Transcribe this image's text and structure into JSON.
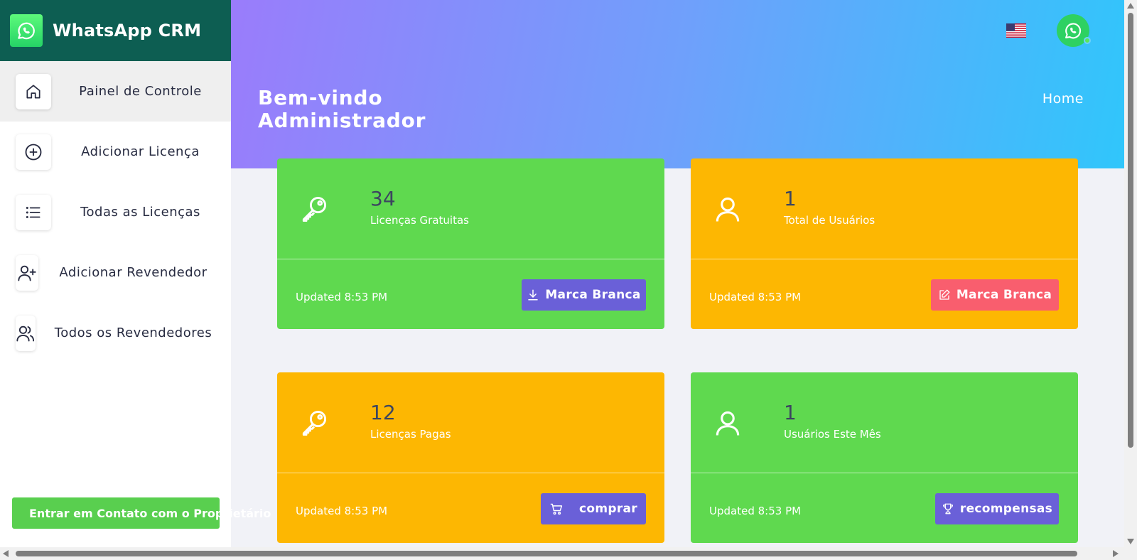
{
  "sidebar": {
    "brand_title": "WhatsApp CRM",
    "brand_icon": "whatsapp-icon",
    "items": [
      {
        "label": "Painel de Controle",
        "icon": "home-icon",
        "active": true
      },
      {
        "label": "Adicionar Licença",
        "icon": "plus-circle-icon",
        "active": false
      },
      {
        "label": "Todas as Licenças",
        "icon": "list-icon",
        "active": false
      },
      {
        "label": "Adicionar Revendedor",
        "icon": "user-plus-icon",
        "active": false
      },
      {
        "label": "Todos os Revendedores",
        "icon": "users-icon",
        "active": false
      }
    ],
    "contact_button": "Entrar em Contato com o Proprietário"
  },
  "header": {
    "welcome_line1": "Bem-vindo",
    "welcome_line2": "Administrador",
    "breadcrumb": "Home",
    "flag": "us-flag-icon",
    "avatar": "whatsapp-icon"
  },
  "cards": [
    {
      "number": "34",
      "label": "Licenças Gratuitas",
      "updated": "Updated 8:53 PM",
      "button": "Marca Branca",
      "button_icon": "download-icon",
      "color": "#5fd94f",
      "icon": "key-icon"
    },
    {
      "number": "1",
      "label": "Total de Usuários",
      "updated": "Updated 8:53 PM",
      "button": "Marca Branca",
      "button_icon": "edit-icon",
      "color": "#fdb702",
      "icon": "user-icon"
    },
    {
      "number": "12",
      "label": "Licenças Pagas",
      "updated": "Updated 8:53 PM",
      "button": "comprar",
      "button_icon": "cart-icon",
      "color": "#fdb702",
      "icon": "key-icon"
    },
    {
      "number": "1",
      "label": "Usuários Este Mês",
      "updated": "Updated 8:53 PM",
      "button": "recompensas",
      "button_icon": "trophy-icon",
      "color": "#5fd94f",
      "icon": "user-icon"
    }
  ],
  "colors": {
    "brand_bg": "#0d5e52",
    "green": "#5fd94f",
    "yellow": "#fdb702",
    "purple_button": "#6a60d8",
    "red_button": "#f95e6e"
  }
}
